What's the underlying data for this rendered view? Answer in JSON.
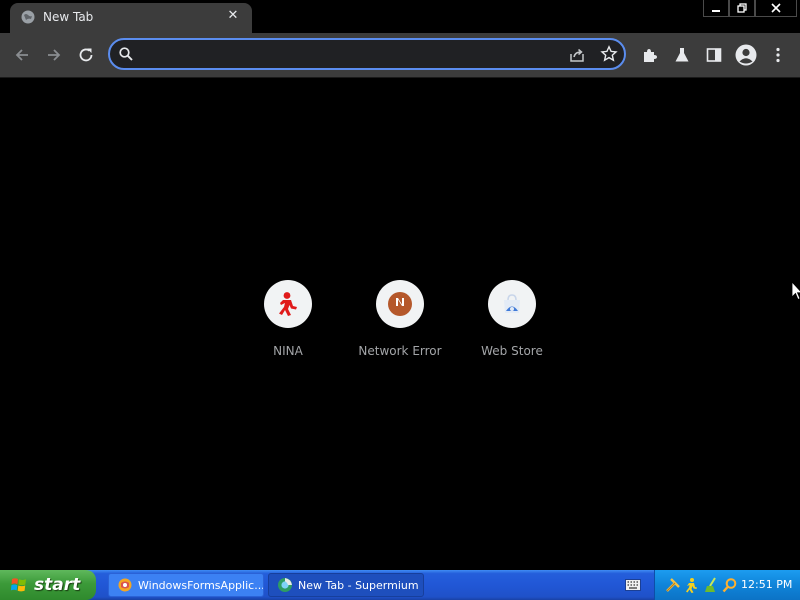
{
  "browser": {
    "tab": {
      "title": "New Tab",
      "favicon": "globe-icon",
      "close_icon": "close-icon"
    },
    "window_controls": [
      "minimize-icon",
      "restore-icon",
      "close-icon"
    ],
    "toolbar": {
      "buttons": [
        "back-arrow-icon",
        "forward-arrow-icon",
        "reload-icon"
      ],
      "omnibox": {
        "value": "",
        "placeholder": "",
        "icons": [
          "search-icon",
          "share-icon",
          "star-icon"
        ]
      },
      "extensions": [
        "puzzle-icon",
        "flask-icon",
        "side-panel-icon",
        "profile-avatar-icon",
        "kebab-menu-icon"
      ]
    },
    "accent_color": "#5b8def"
  },
  "new_tab": {
    "shortcuts": [
      {
        "label": "NINA",
        "icon": "running-man-icon"
      },
      {
        "label": "Network Error",
        "icon": "letter-n-icon"
      },
      {
        "label": "Web Store",
        "icon": "web-store-icon"
      }
    ]
  },
  "taskbar": {
    "start_label": "start",
    "tasks": [
      {
        "label": "WindowsFormsApplic...",
        "icon": "windows-forms-app-icon",
        "active": false
      },
      {
        "label": "New Tab - Supermium",
        "icon": "supermium-icon",
        "active": true
      }
    ],
    "tray_icons": [
      "tools-icon",
      "running-man-icon",
      "broom-icon",
      "search-icon"
    ],
    "clock": "12:51 PM"
  }
}
